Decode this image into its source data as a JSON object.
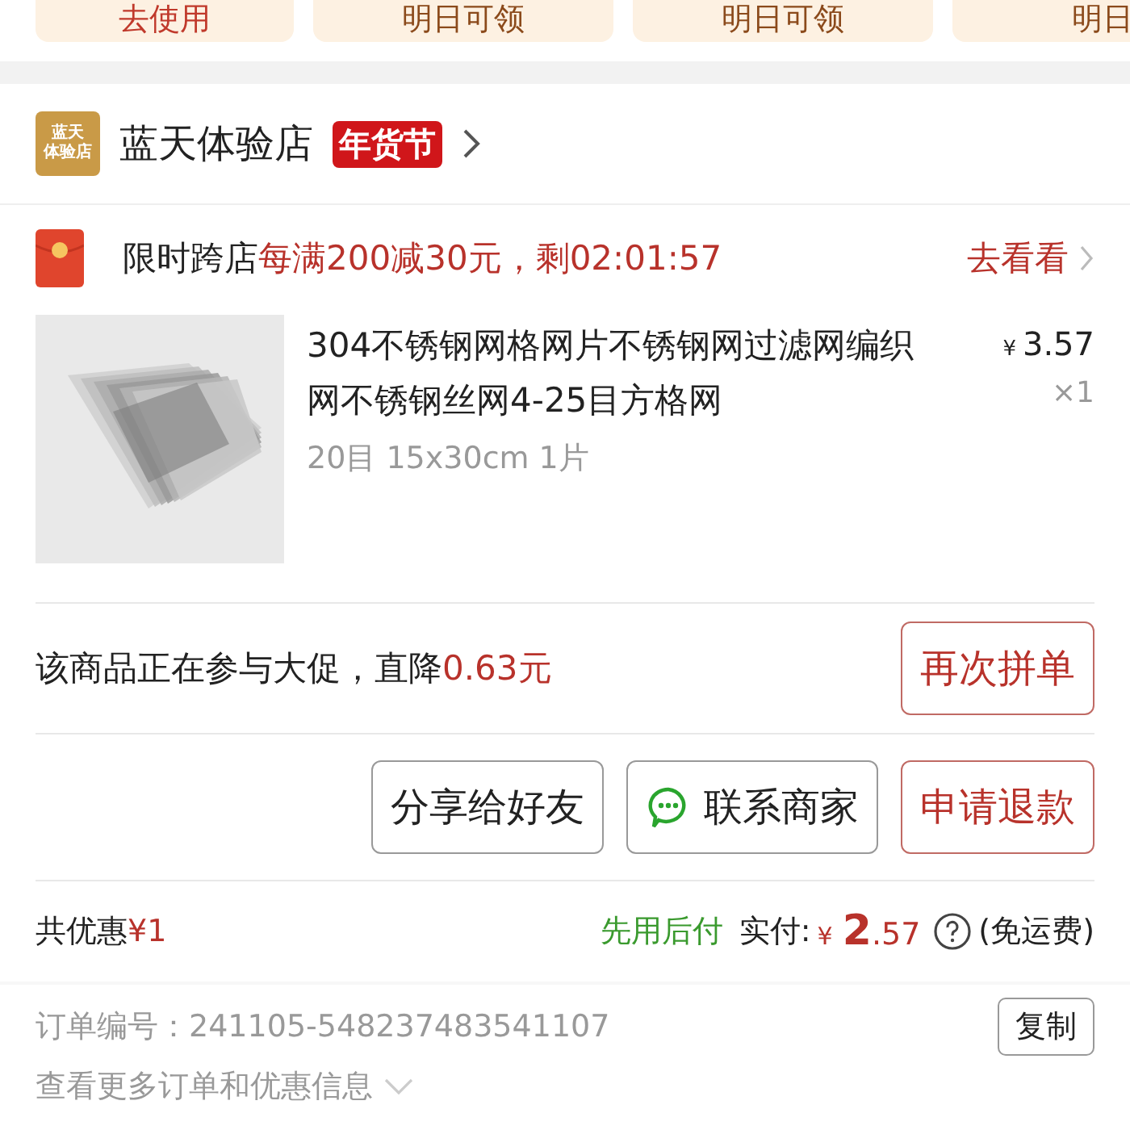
{
  "coupon_strip": [
    {
      "label": "去使用",
      "kind": "use"
    },
    {
      "label": "明日可领",
      "kind": "later"
    },
    {
      "label": "明日可领",
      "kind": "later"
    },
    {
      "label": "明日",
      "kind": "later"
    }
  ],
  "store": {
    "logo_text": [
      "蓝天",
      "体验店"
    ],
    "name": "蓝天体验店",
    "badge": "年货节"
  },
  "promo": {
    "label": "限时跨店",
    "offer": "每满200减30元，剩",
    "countdown": "02:01:57",
    "link": "去看看"
  },
  "product": {
    "title": "304不锈钢网格网片不锈钢网过滤网编织网不锈钢丝网4-25目方格网",
    "spec": "20目 15x30cm 1片",
    "currency": "¥",
    "price": "3.57",
    "quantity": "×1"
  },
  "price_drop": {
    "text": "该商品正在参与大促，直降",
    "amount": "0.63元",
    "button": "再次拼单"
  },
  "actions": [
    {
      "label": "分享给好友",
      "kind": "plain"
    },
    {
      "label": "联系商家",
      "kind": "chat"
    },
    {
      "label": "申请退款",
      "kind": "primary"
    }
  ],
  "summary": {
    "discount_label": "共优惠",
    "discount": "¥1",
    "pay_later": "先用后付",
    "paid_label": "实付:",
    "currency": "¥",
    "paid_int": "2",
    "paid_dec": ".57",
    "shipping": "(免运费)"
  },
  "order": {
    "number_label": "订单编号：",
    "number": "241105-548237483541107",
    "copy": "复制",
    "more": "查看更多订单和优惠信息"
  }
}
